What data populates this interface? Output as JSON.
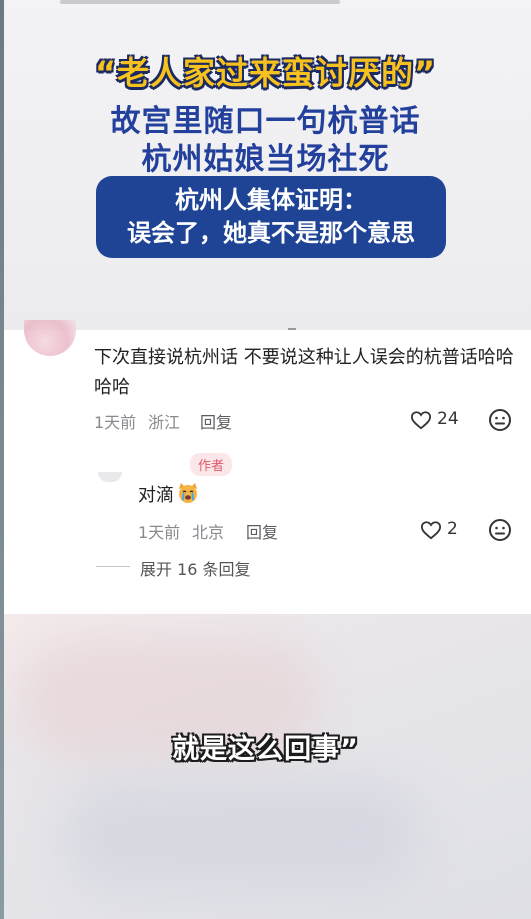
{
  "headline": {
    "quote": "“老人家过来蛮讨厌的”",
    "line1": "故宫里随口一句杭普话",
    "line2": "杭州姑娘当场社死",
    "banner_line1": "杭州人集体证明：",
    "banner_line2": "误会了，她真不是那个意思"
  },
  "comment": {
    "text": "下次直接说杭州话 不要说这种让人误会的杭普话哈哈哈哈",
    "time": "1天前",
    "location": "浙江",
    "reply_label": "回复",
    "likes": "24"
  },
  "reply": {
    "author_tag": "作者",
    "text": "对滴",
    "time": "1天前",
    "location": "北京",
    "reply_label": "回复",
    "likes": "2"
  },
  "expand_label": "展开 16 条回复",
  "subtitle": "就是这么回事”",
  "colors": {
    "headline_yellow": "#f7c21f",
    "headline_blue": "#22409c",
    "banner_blue": "#1f4496",
    "author_tag": "#e05a6a"
  }
}
